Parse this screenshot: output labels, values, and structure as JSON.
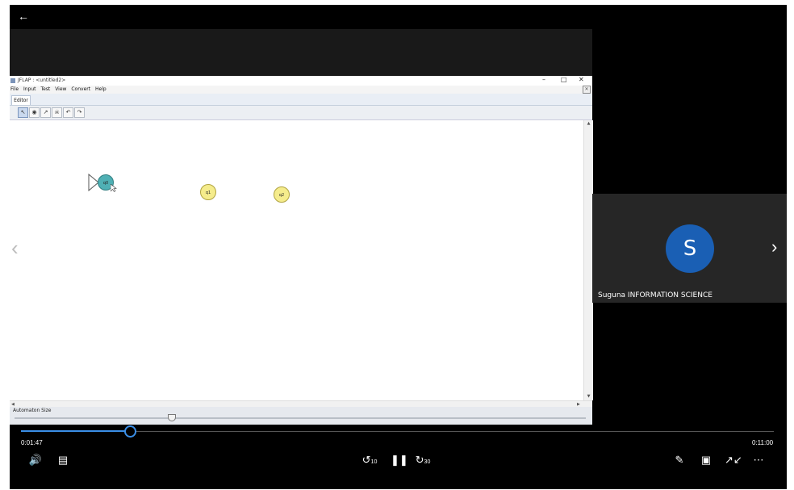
{
  "player": {
    "back_icon": "arrow-left-icon",
    "prev_icon": "chevron-left-icon",
    "next_icon": "chevron-right-icon",
    "accent_color": "#3a8ee6",
    "progress_fraction": 0.147
  },
  "app": {
    "title": "JFLAP : <untitled2>",
    "menu": [
      "File",
      "Input",
      "Test",
      "View",
      "Convert",
      "Help"
    ],
    "tab_label": "Editor",
    "states": [
      "q0",
      "q1",
      "q2"
    ],
    "size_label": "Automaton Size"
  },
  "participant": {
    "initial": "S",
    "name": "Suguna INFORMATION SCIENCE",
    "avatar_color": "#1a5fb4"
  },
  "controls": {
    "elapsed": "0:01:47",
    "total": "0:11:00",
    "rewind_seconds": "10",
    "forward_seconds": "30"
  }
}
